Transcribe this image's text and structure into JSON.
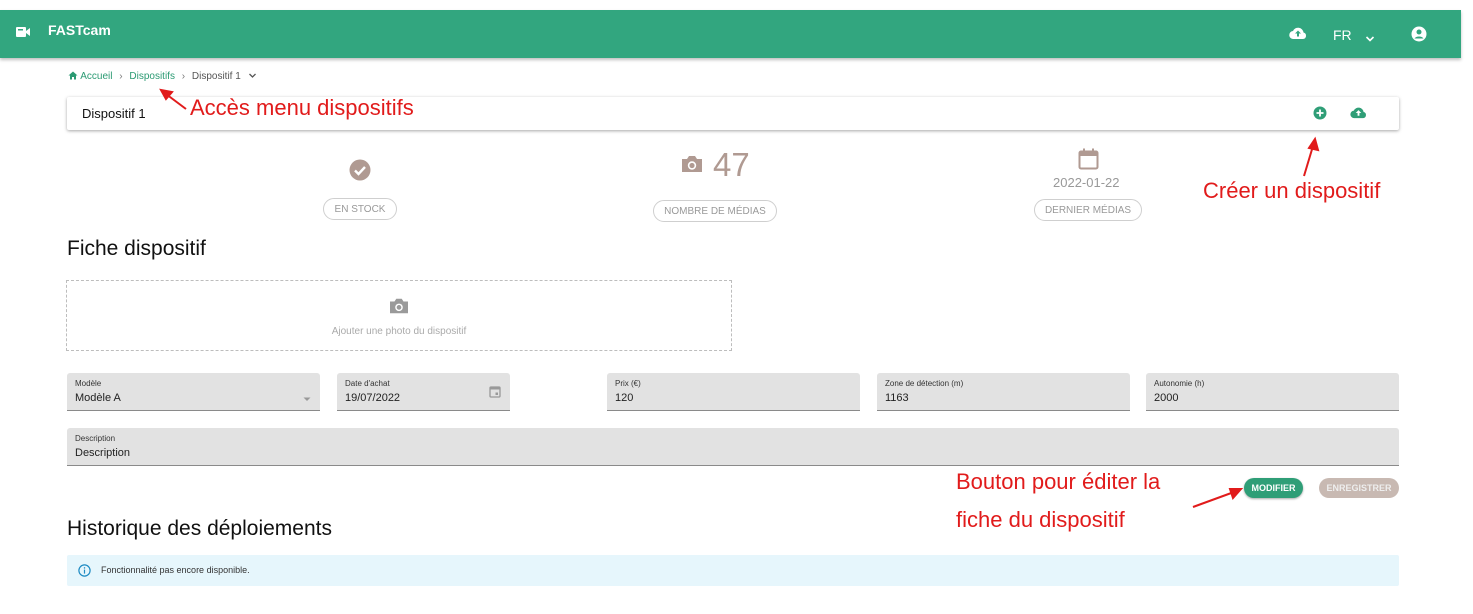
{
  "appbar": {
    "brand": "FASTcam",
    "language": "FR",
    "color": "#32a67f"
  },
  "breadcrumb": {
    "home": "Accueil",
    "section": "Dispositifs",
    "current": "Dispositif 1"
  },
  "title_card": {
    "title": "Dispositif 1"
  },
  "stats": {
    "status": {
      "icon": "check-circle-icon",
      "label": "EN STOCK"
    },
    "media": {
      "icon": "camera-icon",
      "value": "47",
      "label": "NOMBRE DE MÉDIAS"
    },
    "last": {
      "icon": "calendar-icon",
      "value": "2022-01-22",
      "label": "DERNIER MÉDIAS"
    }
  },
  "fiche": {
    "title": "Fiche dispositif",
    "photo_label": "Ajouter une photo du dispositif",
    "fields": {
      "modele": {
        "label": "Modèle",
        "value": "Modèle A"
      },
      "date_achat": {
        "label": "Date d'achat",
        "value": "19/07/2022"
      },
      "prix": {
        "label": "Prix (€)",
        "value": "120"
      },
      "zone": {
        "label": "Zone de détection (m)",
        "value": "1163"
      },
      "autonomie": {
        "label": "Autonomie (h)",
        "value": "2000"
      },
      "description": {
        "label": "Description",
        "value": "Description"
      }
    },
    "modify_button": "MODIFIER",
    "save_button": "ENREGISTRER"
  },
  "history": {
    "title": "Historique des déploiements",
    "info": "Fonctionnalité pas encore disponible."
  },
  "annotations": {
    "menu": "Accès menu dispositifs",
    "create": "Créer un dispositif",
    "edit_line1": "Bouton pour éditer la",
    "edit_line2": "fiche du dispositif",
    "color": "#e11b1b"
  }
}
